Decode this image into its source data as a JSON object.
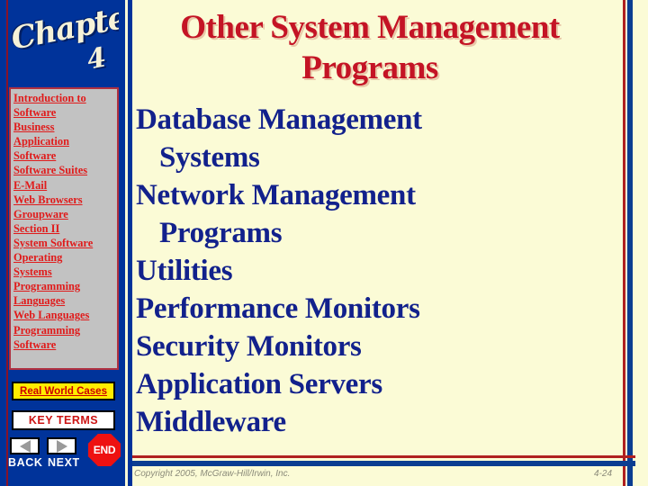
{
  "slide": {
    "title": "Other System Management Programs",
    "title_color": "#c41425",
    "background_color": "#fbfbd6",
    "body_color": "#12218c",
    "accent_blue": "#00339a"
  },
  "chapter_badge": {
    "word": "Chapter",
    "number": "4"
  },
  "sidebar": {
    "topics": [
      {
        "label": "Introduction to"
      },
      {
        "label": "Software"
      },
      {
        "label": "Business"
      },
      {
        "label": "Application"
      },
      {
        "label": "Software"
      },
      {
        "label": "Software Suites"
      },
      {
        "label": "E-Mail"
      },
      {
        "label": "Web Browsers"
      },
      {
        "label": "Groupware"
      },
      {
        "label": "Section II"
      },
      {
        "label": "System Software"
      },
      {
        "label": "Operating"
      },
      {
        "label": "Systems"
      },
      {
        "label": "Programming"
      },
      {
        "label": "Languages"
      },
      {
        "label": "Web Languages"
      },
      {
        "label": "Programming"
      },
      {
        "label": "Software"
      }
    ],
    "real_world_cases_label": "Real World Cases",
    "key_terms_label": "KEY TERMS",
    "back_label": "BACK",
    "next_label": "NEXT",
    "end_label": "END"
  },
  "body": {
    "lines": [
      {
        "text": "Database Management",
        "continuation": false
      },
      {
        "text": "Systems",
        "continuation": true
      },
      {
        "text": "Network Management",
        "continuation": false
      },
      {
        "text": "Programs",
        "continuation": true
      },
      {
        "text": "Utilities",
        "continuation": false
      },
      {
        "text": "Performance Monitors",
        "continuation": false
      },
      {
        "text": "Security Monitors",
        "continuation": false
      },
      {
        "text": "Application Servers",
        "continuation": false
      },
      {
        "text": "Middleware",
        "continuation": false
      }
    ]
  },
  "footer": {
    "copyright": "Copyright 2005, McGraw-Hill/Irwin, Inc.",
    "page_number": "4-24"
  }
}
